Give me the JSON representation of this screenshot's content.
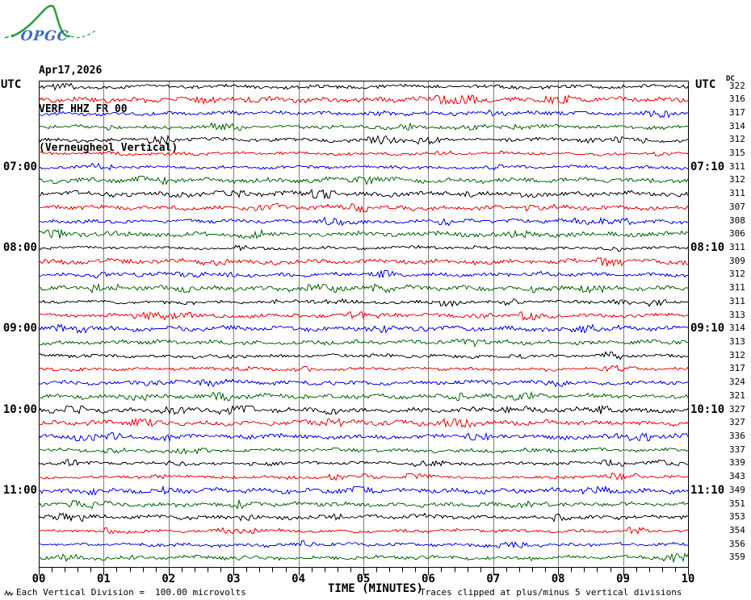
{
  "logo": {
    "text": "OPGC"
  },
  "header": {
    "date": "Apr17,2026",
    "station_code": "VERF HHZ FR 00",
    "station_name": "(Verneugheol Vertical)"
  },
  "axes": {
    "left_time_header": "UTC",
    "right_time_header": "UTC",
    "dc_header": "DC",
    "x_tick_labels": [
      "00",
      "01",
      "02",
      "03",
      "04",
      "05",
      "06",
      "07",
      "08",
      "09",
      "10"
    ],
    "x_axis_title": "TIME (MINUTES)"
  },
  "footer": {
    "left_note": "Each Vertical Division =  100.00 microvolts",
    "right_note": "Traces clipped at plus/minus 5 vertical divisions"
  },
  "colors": {
    "trace_cycle": [
      "#000000",
      "#ee0000",
      "#0000ee",
      "#006600"
    ],
    "grid": "#7f7f7f",
    "border": "#000000",
    "logo_curve": "#2f9e41",
    "logo_text": "#3a6bc4"
  },
  "rows": [
    {
      "dc": "322"
    },
    {
      "dc": "316"
    },
    {
      "dc": "317"
    },
    {
      "dc": "314"
    },
    {
      "dc": "312"
    },
    {
      "dc": "315"
    },
    {
      "dc": "311",
      "left": "07:00",
      "right": "07:10"
    },
    {
      "dc": "312"
    },
    {
      "dc": "311"
    },
    {
      "dc": "307"
    },
    {
      "dc": "308"
    },
    {
      "dc": "306"
    },
    {
      "dc": "311",
      "left": "08:00",
      "right": "08:10"
    },
    {
      "dc": "309"
    },
    {
      "dc": "312"
    },
    {
      "dc": "311"
    },
    {
      "dc": "311"
    },
    {
      "dc": "313"
    },
    {
      "dc": "314",
      "left": "09:00",
      "right": "09:10"
    },
    {
      "dc": "313"
    },
    {
      "dc": "312"
    },
    {
      "dc": "317"
    },
    {
      "dc": "324"
    },
    {
      "dc": "321"
    },
    {
      "dc": "327",
      "left": "10:00",
      "right": "10:10"
    },
    {
      "dc": "327"
    },
    {
      "dc": "336"
    },
    {
      "dc": "337"
    },
    {
      "dc": "339"
    },
    {
      "dc": "343"
    },
    {
      "dc": "349",
      "left": "11:00",
      "right": "11:10"
    },
    {
      "dc": "351"
    },
    {
      "dc": "353"
    },
    {
      "dc": "354"
    },
    {
      "dc": "356"
    },
    {
      "dc": "359"
    }
  ],
  "chart_data": {
    "type": "line",
    "title": "VERF HHZ FR 00 (Verneugheol Vertical) helicorder, Apr17,2026",
    "xlabel": "TIME (MINUTES)",
    "x_ticks": [
      "00",
      "01",
      "02",
      "03",
      "04",
      "05",
      "06",
      "07",
      "08",
      "09",
      "10"
    ],
    "xlim": [
      0,
      10
    ],
    "minutes_per_row": 10,
    "row_count": 36,
    "grid": "vertical gridlines at each minute",
    "left_hour_labels": [
      {
        "row": 7,
        "label": "07:00"
      },
      {
        "row": 13,
        "label": "08:00"
      },
      {
        "row": 19,
        "label": "09:00"
      },
      {
        "row": 25,
        "label": "10:00"
      },
      {
        "row": 31,
        "label": "11:00"
      }
    ],
    "right_hour_labels": [
      {
        "row": 7,
        "label": "07:10"
      },
      {
        "row": 13,
        "label": "08:10"
      },
      {
        "row": 19,
        "label": "09:10"
      },
      {
        "row": 25,
        "label": "10:10"
      },
      {
        "row": 31,
        "label": "11:10"
      }
    ],
    "series": [
      {
        "name": "DC offset per trace row",
        "values": [
          322,
          316,
          317,
          314,
          312,
          315,
          311,
          312,
          311,
          307,
          308,
          306,
          311,
          309,
          312,
          311,
          311,
          313,
          314,
          313,
          312,
          317,
          324,
          321,
          327,
          327,
          336,
          337,
          339,
          343,
          349,
          351,
          353,
          354,
          356,
          359
        ]
      }
    ]
  }
}
